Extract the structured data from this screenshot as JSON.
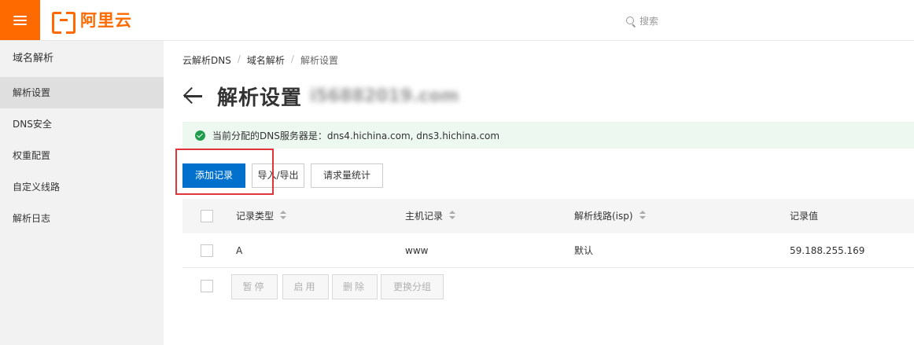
{
  "header": {
    "logo_text": "阿里云",
    "search_placeholder": "搜索"
  },
  "sidebar": {
    "title": "域名解析",
    "items": [
      {
        "label": "解析设置",
        "active": true
      },
      {
        "label": "DNS安全",
        "active": false
      },
      {
        "label": "权重配置",
        "active": false
      },
      {
        "label": "自定义线路",
        "active": false
      },
      {
        "label": "解析日志",
        "active": false
      }
    ]
  },
  "breadcrumb": [
    "云解析DNS",
    "域名解析",
    "解析设置"
  ],
  "page": {
    "title": "解析设置",
    "domain": "i56882019.com"
  },
  "alert": {
    "text": "当前分配的DNS服务器是：dns4.hichina.com, dns3.hichina.com"
  },
  "toolbar": {
    "add_label": "添加记录",
    "import_export_label": "导入/导出",
    "stats_label": "请求量统计"
  },
  "table": {
    "columns": [
      "记录类型",
      "主机记录",
      "解析线路(isp)",
      "记录值"
    ],
    "rows": [
      [
        "A",
        "www",
        "默认",
        "59.188.255.169"
      ]
    ]
  },
  "batch": {
    "pause_label": "暂停",
    "enable_label": "启用",
    "delete_label": "删除",
    "group_label": "更换分组"
  },
  "colors": {
    "brand_orange": "#ff6a00",
    "primary_blue": "#0070cc",
    "success_green": "#1e9b4b",
    "highlight_red": "#e0353b"
  }
}
